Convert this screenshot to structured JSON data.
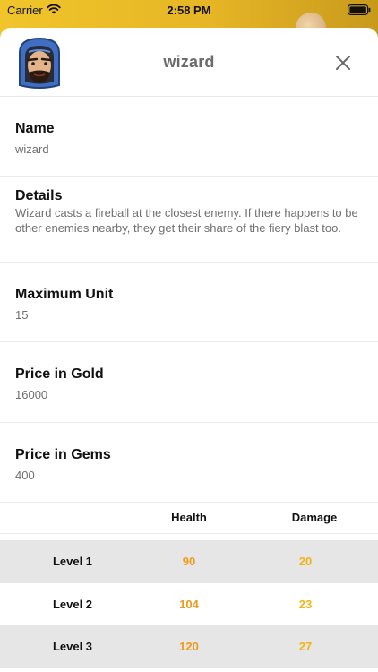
{
  "status_bar": {
    "carrier": "Carrier",
    "time": "2:58 PM",
    "wifi_icon": "wifi-icon",
    "battery_icon": "battery-icon"
  },
  "sheet": {
    "title": "wizard",
    "avatar_icon": "wizard-avatar-icon",
    "close_icon": "close-icon"
  },
  "fields": {
    "name": {
      "label": "Name",
      "value": "wizard"
    },
    "details": {
      "label": "Details",
      "value": "Wizard casts a fireball at the closest enemy. If there happens to be other enemies nearby, they get their share of the fiery blast too."
    },
    "max_unit": {
      "label": "Maximum Unit",
      "value": "15"
    },
    "price_gold": {
      "label": "Price in Gold",
      "value": "16000"
    },
    "price_gems": {
      "label": "Price in Gems",
      "value": "400"
    }
  },
  "stats_table": {
    "headers": {
      "health": "Health",
      "damage": "Damage"
    },
    "rows": [
      {
        "level": "Level 1",
        "health": "90",
        "damage": "20"
      },
      {
        "level": "Level 2",
        "health": "104",
        "damage": "23"
      },
      {
        "level": "Level 3",
        "health": "120",
        "damage": "27"
      }
    ]
  },
  "colors": {
    "health": "#f09a17",
    "damage": "#f1b417",
    "header_gold": "#e6b626"
  }
}
